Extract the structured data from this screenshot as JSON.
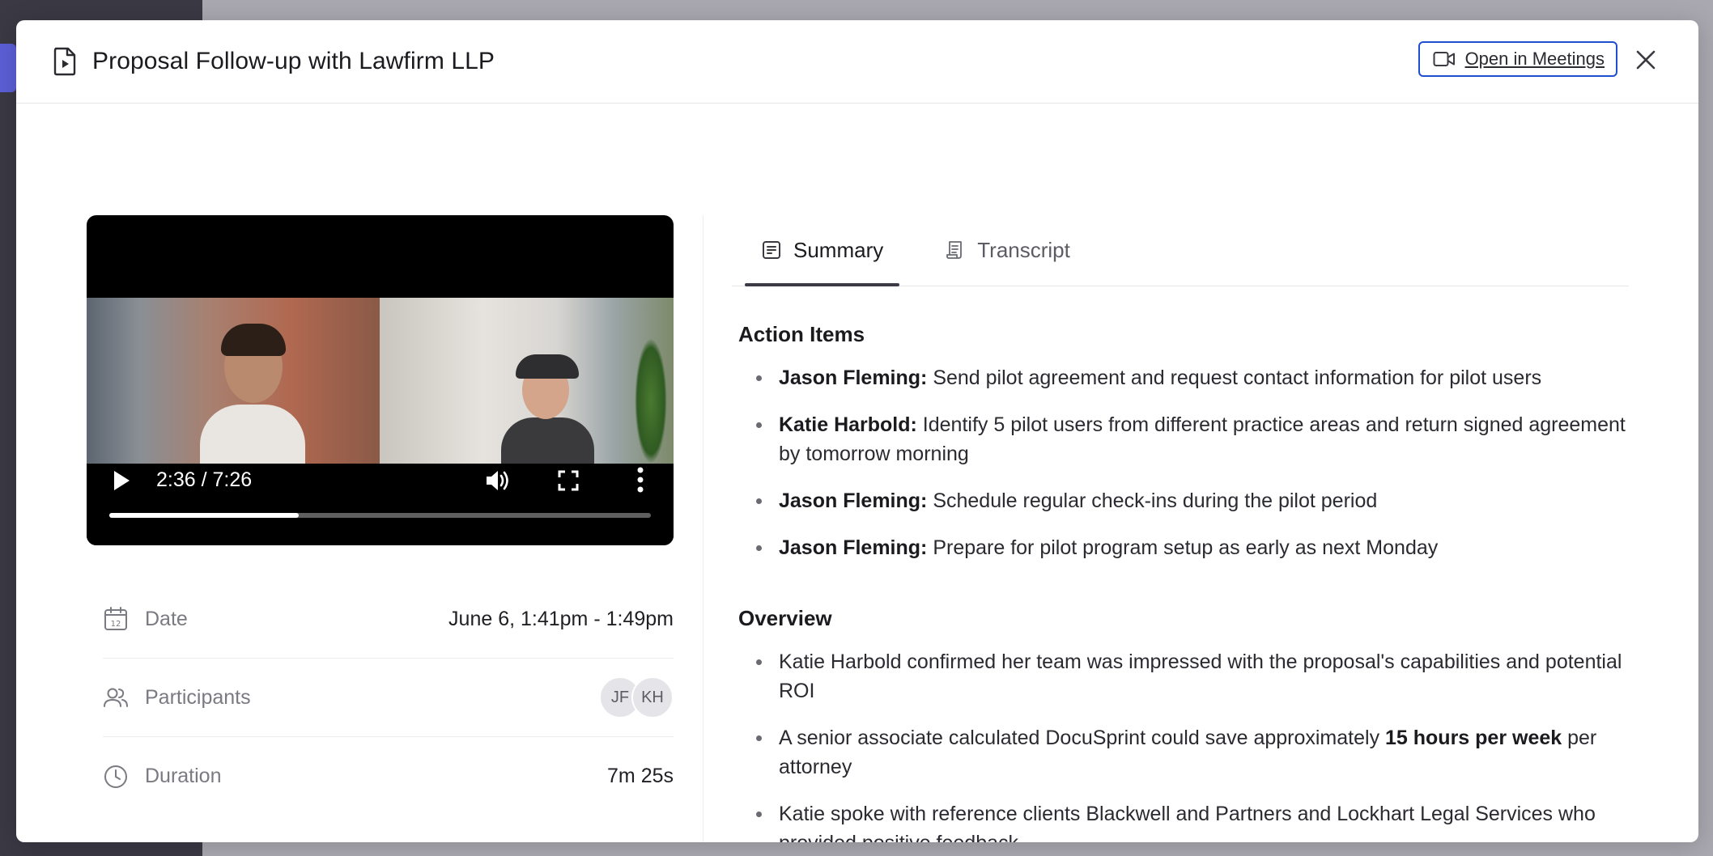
{
  "modal": {
    "title": "Proposal Follow-up with Lawfirm LLP",
    "open_label": "Open in Meetings"
  },
  "video": {
    "time": "2:36 / 7:26",
    "progress": 0.35
  },
  "meta": {
    "date_label": "Date",
    "date_value": "June 6, 1:41pm - 1:49pm",
    "participants_label": "Participants",
    "participants": [
      "JF",
      "KH"
    ],
    "duration_label": "Duration",
    "duration_value": "7m 25s"
  },
  "tabs": [
    {
      "label": "Summary",
      "active": true
    },
    {
      "label": "Transcript",
      "active": false
    }
  ],
  "summary": {
    "action_items_title": "Action Items",
    "action_items": [
      {
        "who": "Jason Fleming:",
        "text": " Send pilot agreement and request contact information for pilot users"
      },
      {
        "who": "Katie Harbold:",
        "text": " Identify 5 pilot users from different practice areas and return signed agreement by tomorrow morning"
      },
      {
        "who": "Jason Fleming:",
        "text": " Schedule regular check-ins during the pilot period"
      },
      {
        "who": "Jason Fleming:",
        "text": " Prepare for pilot program setup as early as next Monday"
      }
    ],
    "overview_title": "Overview",
    "overview": [
      {
        "pre": "Katie Harbold confirmed her team was impressed with the proposal's capabilities and potential ROI",
        "bold": "",
        "post": ""
      },
      {
        "pre": "A senior associate calculated DocuSprint could save approximately ",
        "bold": "15 hours per week",
        "post": " per attorney"
      },
      {
        "pre": "Katie spoke with reference clients Blackwell and Partners and Lockhart Legal Services who provided positive feedback",
        "bold": "",
        "post": ""
      }
    ]
  }
}
